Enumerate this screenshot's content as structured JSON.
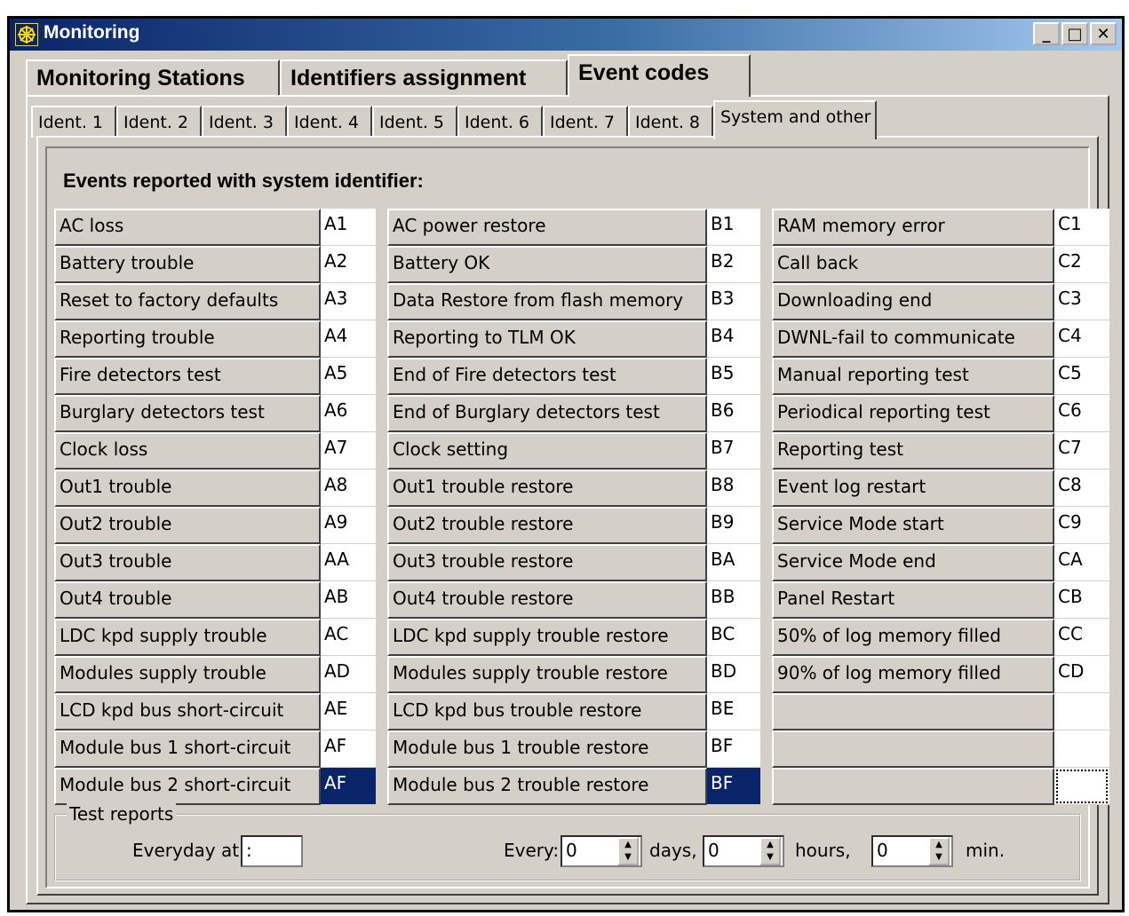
{
  "window": {
    "title": "Monitoring",
    "minimize": "_",
    "maximize": "□",
    "close": "✕"
  },
  "main_tabs": [
    "Monitoring Stations",
    "Identifiers assignment",
    "Event codes"
  ],
  "sub_tabs": [
    "Ident. 1",
    "Ident. 2",
    "Ident. 3",
    "Ident. 4",
    "Ident. 5",
    "Ident. 6",
    "Ident. 7",
    "Ident. 8",
    "System and other"
  ],
  "heading": "Events reported with system identifier:",
  "columns": [
    {
      "rows": [
        {
          "name": "AC loss",
          "code": "A1"
        },
        {
          "name": "Battery trouble",
          "code": "A2"
        },
        {
          "name": "Reset to factory defaults",
          "code": "A3"
        },
        {
          "name": "Reporting trouble",
          "code": "A4"
        },
        {
          "name": "Fire detectors test",
          "code": "A5"
        },
        {
          "name": "Burglary detectors test",
          "code": "A6"
        },
        {
          "name": "Clock loss",
          "code": "A7"
        },
        {
          "name": "Out1 trouble",
          "code": "A8"
        },
        {
          "name": "Out2 trouble",
          "code": "A9"
        },
        {
          "name": "Out3 trouble",
          "code": "AA"
        },
        {
          "name": "Out4 trouble",
          "code": "AB"
        },
        {
          "name": "LDC kpd supply trouble",
          "code": "AC"
        },
        {
          "name": "Modules supply trouble",
          "code": "AD"
        },
        {
          "name": "LCD kpd bus short-circuit",
          "code": "AE"
        },
        {
          "name": "Module bus 1 short-circuit",
          "code": "AF"
        },
        {
          "name": "Module bus 2 short-circuit",
          "code": "AF"
        }
      ]
    },
    {
      "rows": [
        {
          "name": "AC power restore",
          "code": "B1"
        },
        {
          "name": "Battery OK",
          "code": "B2"
        },
        {
          "name": "Data Restore from flash memory",
          "code": "B3"
        },
        {
          "name": "Reporting to TLM OK",
          "code": "B4"
        },
        {
          "name": "End of Fire detectors test",
          "code": "B5"
        },
        {
          "name": "End of Burglary detectors test",
          "code": "B6"
        },
        {
          "name": "Clock setting",
          "code": "B7"
        },
        {
          "name": "Out1 trouble restore",
          "code": "B8"
        },
        {
          "name": "Out2 trouble restore",
          "code": "B9"
        },
        {
          "name": "Out3 trouble restore",
          "code": "BA"
        },
        {
          "name": "Out4 trouble restore",
          "code": "BB"
        },
        {
          "name": "LDC kpd supply trouble restore",
          "code": "BC"
        },
        {
          "name": "Modules supply trouble restore",
          "code": "BD"
        },
        {
          "name": "LCD kpd bus trouble restore",
          "code": "BE"
        },
        {
          "name": "Module bus 1 trouble restore",
          "code": "BF"
        },
        {
          "name": "Module bus 2 trouble restore",
          "code": "BF"
        }
      ]
    },
    {
      "rows": [
        {
          "name": "RAM memory error",
          "code": "C1"
        },
        {
          "name": "Call back",
          "code": "C2"
        },
        {
          "name": "Downloading end",
          "code": "C3"
        },
        {
          "name": "DWNL-fail to communicate",
          "code": "C4"
        },
        {
          "name": "Manual reporting test",
          "code": "C5"
        },
        {
          "name": "Periodical reporting test",
          "code": "C6"
        },
        {
          "name": "Reporting test",
          "code": "C7"
        },
        {
          "name": "Event log restart",
          "code": "C8"
        },
        {
          "name": "Service Mode start",
          "code": "C9"
        },
        {
          "name": "Service Mode end",
          "code": "CA"
        },
        {
          "name": "Panel Restart",
          "code": "CB"
        },
        {
          "name": "50% of log memory filled",
          "code": "CC"
        },
        {
          "name": "90% of log memory filled",
          "code": "CD"
        },
        {
          "name": "",
          "code": ""
        },
        {
          "name": "",
          "code": ""
        },
        {
          "name": "",
          "code": ""
        }
      ]
    }
  ],
  "test_reports": {
    "legend": "Test reports",
    "everyday_label": "Everyday at:",
    "everyday_value": " :",
    "every_label": "Every:",
    "days_value": "0",
    "days_label": "days,",
    "hours_value": "0",
    "hours_label": "hours,",
    "min_value": "0",
    "min_label": "min."
  },
  "colors": {
    "selection": "#0a246a",
    "face": "#d4d0c8",
    "title_start": "#0a246a",
    "title_end": "#a6caf0"
  }
}
